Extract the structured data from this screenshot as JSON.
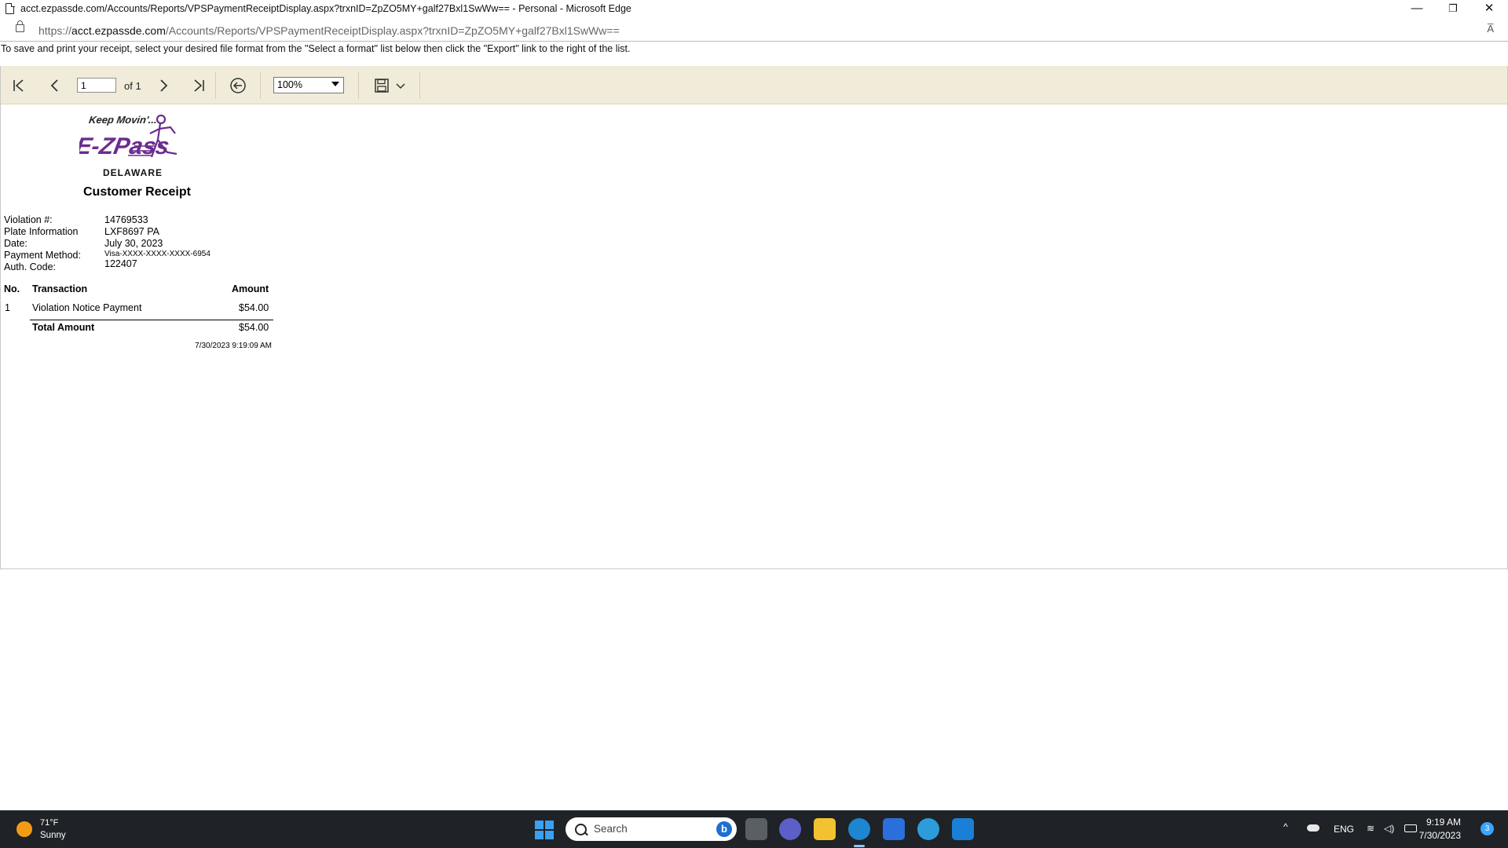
{
  "window": {
    "title": "acct.ezpassde.com/Accounts/Reports/VPSPaymentReceiptDisplay.aspx?trxnID=ZpZO5MY+galf27Bxl1SwWw== - Personal - Microsoft Edge",
    "minimize": "—",
    "restore": "❐",
    "close": "✕"
  },
  "address_bar": {
    "scheme": "https://",
    "host": "acct.ezpassde.com",
    "path": "/Accounts/Reports/VPSPaymentReceiptDisplay.aspx?trxnID=ZpZO5MY+galf27Bxl1SwWw==",
    "read_aloud_icon": "read-aloud-icon",
    "read_aloud_glyph": "A̅"
  },
  "instructions": "To save and print your receipt, select your desired file format from the \"Select a format\" list below then click the \"Export\" link to the right of the list.",
  "toolbar": {
    "first_page": "|◁",
    "prev_page": "‹",
    "page_value": "1",
    "of_label": "of 1",
    "next_page": "›",
    "last_page": "▷|",
    "back_glyph": "⊖",
    "zoom_value": "100%",
    "save_glyph": "💾",
    "dropdown_glyph": "⌄",
    "background_color": "#f1ecd9"
  },
  "receipt": {
    "logo": {
      "tagline": "Keep Movin'...",
      "brand": "E-ZPass",
      "state": "DELAWARE",
      "color": "#6b2c8f"
    },
    "title": "Customer Receipt",
    "info": [
      {
        "label": "Violation #:",
        "value": "14769533"
      },
      {
        "label": "Plate Information",
        "value": "LXF8697 PA"
      },
      {
        "label": "Date:",
        "value": "July 30, 2023"
      },
      {
        "label": "Payment Method:",
        "value": "Visa-XXXX-XXXX-XXXX-6954"
      },
      {
        "label": "Auth. Code:",
        "value": "122407"
      }
    ],
    "table": {
      "headers": {
        "no": "No.",
        "transaction": "Transaction",
        "amount": "Amount"
      },
      "rows": [
        {
          "no": "1",
          "transaction": "Violation Notice Payment",
          "amount": "$54.00"
        }
      ],
      "total_label": "Total Amount",
      "total_amount": "$54.00"
    },
    "timestamp": "7/30/2023 9:19:09 AM"
  },
  "taskbar": {
    "weather_temp": "71°F",
    "weather_desc": "Sunny",
    "search_placeholder": "Search",
    "search_badge": "b",
    "tray_language": "ENG",
    "tray_chevron": "^",
    "clock_time": "9:19 AM",
    "clock_date": "7/30/2023",
    "notification_count": "3"
  }
}
